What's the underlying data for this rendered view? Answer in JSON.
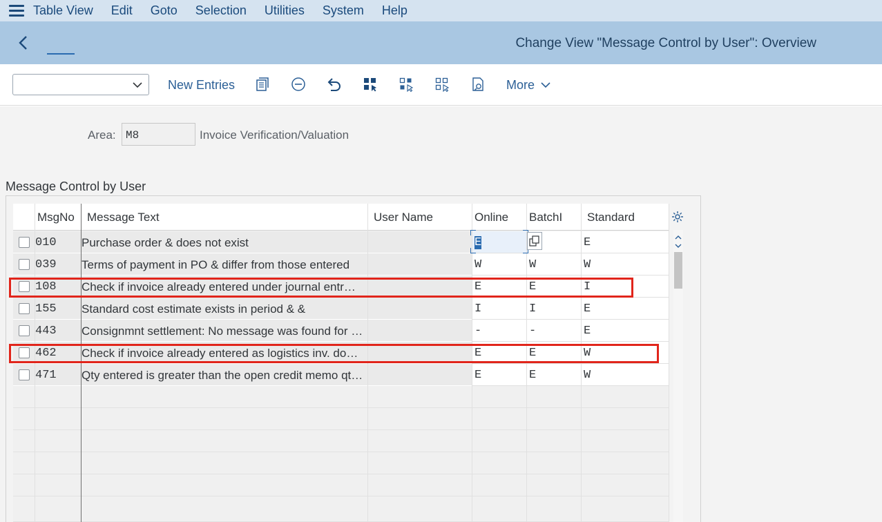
{
  "menu": [
    "Table View",
    "Edit",
    "Goto",
    "Selection",
    "Utilities",
    "System",
    "Help"
  ],
  "title": "Change View \"Message Control by User\": Overview",
  "toolbar": {
    "dropdown_value": "",
    "new_entries": "New Entries",
    "more": "More"
  },
  "area": {
    "label": "Area:",
    "value": "M8",
    "description": "Invoice Verification/Valuation"
  },
  "section_title": "Message Control by User",
  "table": {
    "headers": {
      "msgno": "MsgNo",
      "text": "Message Text",
      "user": "User Name",
      "online": "Online",
      "batch": "BatchI",
      "standard": "Standard"
    },
    "rows": [
      {
        "msgno": "010",
        "text": "Purchase order & does not exist",
        "user": "",
        "online": "E",
        "batch": "",
        "standard": "E"
      },
      {
        "msgno": "039",
        "text": "Terms of payment in PO & differ from those entered",
        "user": "",
        "online": "W",
        "batch": "W",
        "standard": "W"
      },
      {
        "msgno": "108",
        "text": "Check if invoice already entered under journal entr…",
        "user": "",
        "online": "E",
        "batch": "E",
        "standard": "I"
      },
      {
        "msgno": "155",
        "text": "Standard cost estimate exists in period & &",
        "user": "",
        "online": "I",
        "batch": "I",
        "standard": "E"
      },
      {
        "msgno": "443",
        "text": "Consignmnt settlement: No message was found for …",
        "user": "",
        "online": "-",
        "batch": "-",
        "standard": "E"
      },
      {
        "msgno": "462",
        "text": "Check if invoice already entered as logistics inv. do…",
        "user": "",
        "online": "E",
        "batch": "E",
        "standard": "W"
      },
      {
        "msgno": "471",
        "text": "Qty entered is greater than the open credit memo qt…",
        "user": "",
        "online": "E",
        "batch": "E",
        "standard": "W"
      }
    ]
  },
  "colors": {
    "menubar_bg": "#d5e3f0",
    "titlebar_bg": "#a9c7e2",
    "link": "#2b5f96",
    "highlight": "#e1251b"
  }
}
